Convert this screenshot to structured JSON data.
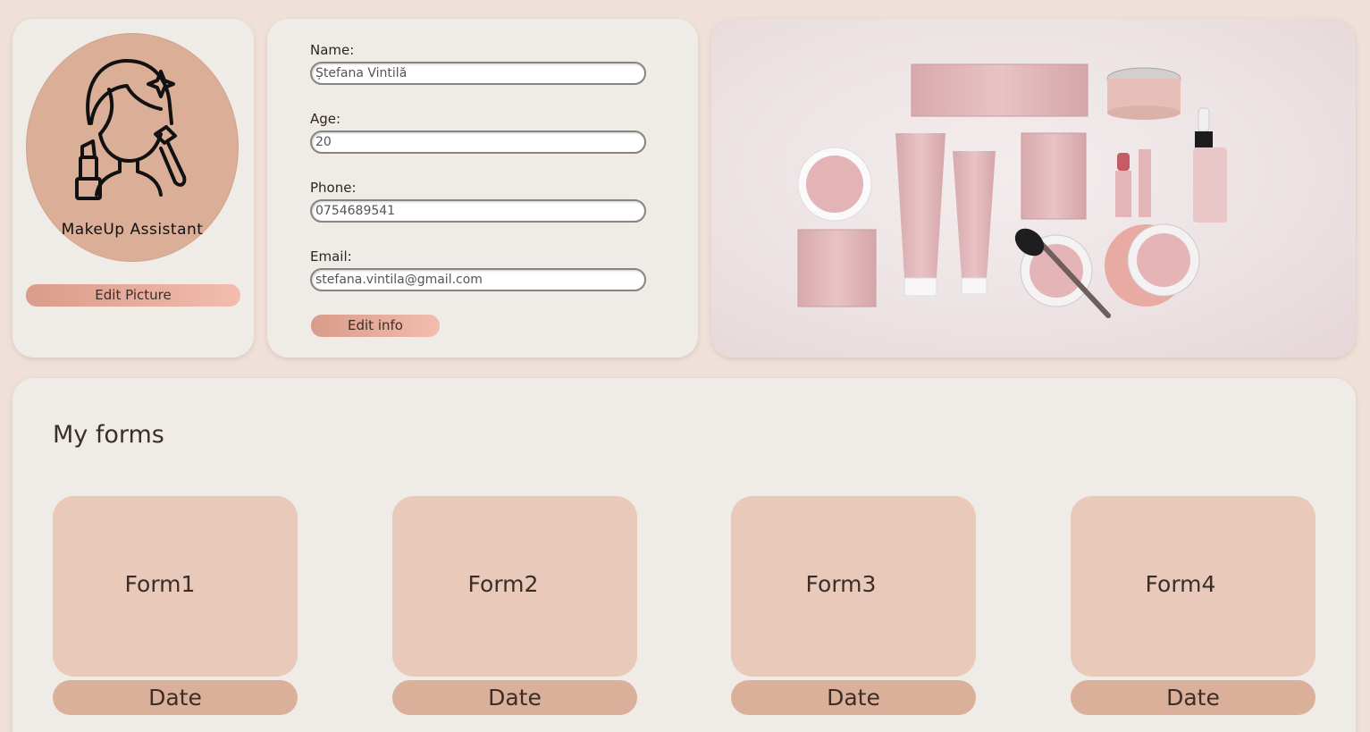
{
  "profile": {
    "avatar_caption": "MakeUp Assistant",
    "edit_picture_label": "Edit Picture"
  },
  "info": {
    "name_label": "Name:",
    "name_value": "Ștefana Vintilă",
    "age_label": "Age:",
    "age_value": "20",
    "phone_label": "Phone:",
    "phone_value": "0754689541",
    "email_label": "Email:",
    "email_value": "stefana.vintila@gmail.com",
    "edit_info_label": "Edit info"
  },
  "forms": {
    "title": "My forms",
    "items": [
      {
        "label": "Form1",
        "date": "Date"
      },
      {
        "label": "Form2",
        "date": "Date"
      },
      {
        "label": "Form3",
        "date": "Date"
      },
      {
        "label": "Form4",
        "date": "Date"
      }
    ]
  },
  "colors": {
    "background": "#efe1d9",
    "card": "#efece7",
    "accent": "#dbae98",
    "tile": "#e9c9b9",
    "date_pill": "#dbb09a"
  }
}
